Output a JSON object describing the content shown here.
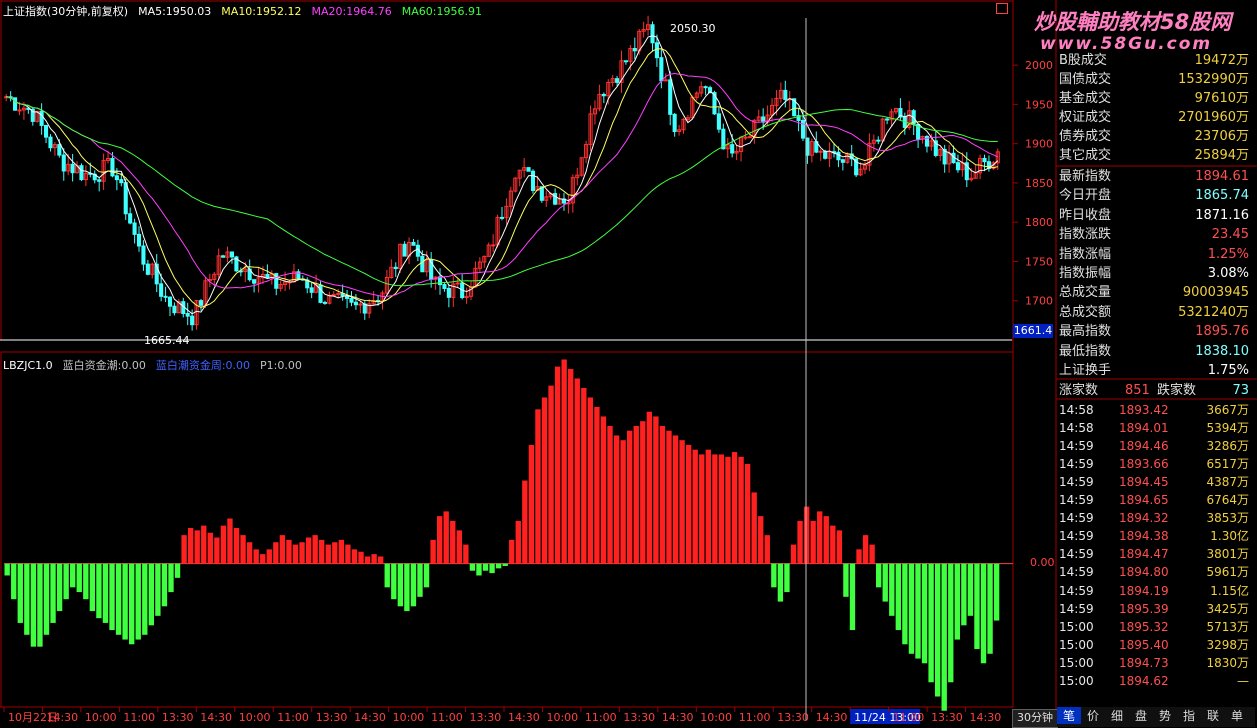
{
  "header": {
    "title": "上证指数(30分钟,前复权)",
    "ma5": "MA5:1950.03",
    "ma10": "MA10:1952.12",
    "ma20": "MA20:1964.76",
    "ma60": "MA60:1956.91"
  },
  "indicator_header": {
    "name": "LBZJC1.0",
    "blue_flow": "蓝白资金潮:0.00",
    "blue_wave": "蓝白潮资金周:0.00",
    "p1": "P1:0.00"
  },
  "watermark": {
    "line1": "炒股輔助教材58股网",
    "line2": "www.58Gu.com"
  },
  "price_labels": {
    "high_label": "2050.30",
    "low_label": "1665.44",
    "current_box": "1661.4",
    "zero_label": "0.00"
  },
  "x_axis_labels": [
    "10月22日",
    "14:30",
    "10:00",
    "11:00",
    "13:30",
    "14:30",
    "10:00",
    "11:00",
    "13:30",
    "14:30",
    "10:00",
    "11:00",
    "13:30",
    "14:30",
    "10:00",
    "11:00",
    "13:30",
    "14:30",
    "10:00",
    "11:00",
    "13:30",
    "14:30",
    "11/24 13:00",
    "11:00",
    "13:30",
    "14:30"
  ],
  "timeframe_label": "30分钟",
  "right_panel": {
    "top_rows": [
      {
        "label": "B股成交",
        "value": "19472万"
      },
      {
        "label": "国债成交",
        "value": "1532990万"
      },
      {
        "label": "基金成交",
        "value": "97610万"
      },
      {
        "label": "权证成交",
        "value": "2701960万"
      },
      {
        "label": "债券成交",
        "value": "23706万"
      },
      {
        "label": "其它成交",
        "value": "25894万"
      }
    ],
    "index_rows": [
      {
        "label": "最新指数",
        "value": "1894.61",
        "color": "#ff5050"
      },
      {
        "label": "今日开盘",
        "value": "1865.74",
        "color": "#80ffff"
      },
      {
        "label": "昨日收盘",
        "value": "1871.16",
        "color": "#ffffff"
      },
      {
        "label": "指数涨跌",
        "value": "23.45",
        "color": "#ff5050"
      },
      {
        "label": "指数涨幅",
        "value": "1.25%",
        "color": "#ff5050"
      },
      {
        "label": "指数振幅",
        "value": "3.08%",
        "color": "#ffffff"
      },
      {
        "label": "总成交量",
        "value": "90003945",
        "color": "#f0d040"
      },
      {
        "label": "总成交额",
        "value": "5321240万",
        "color": "#f0d040"
      },
      {
        "label": "最高指数",
        "value": "1895.76",
        "color": "#ff5050"
      },
      {
        "label": "最低指数",
        "value": "1838.10",
        "color": "#80ffff"
      },
      {
        "label": "上证换手",
        "value": "1.75%",
        "color": "#ffffff"
      }
    ],
    "breadth": {
      "up_label": "涨家数",
      "up_value": "851",
      "down_label": "跌家数",
      "down_value": "73"
    },
    "ticks": [
      {
        "time": "14:58",
        "price": "1893.42",
        "vol": "3667万"
      },
      {
        "time": "14:58",
        "price": "1894.01",
        "vol": "5394万"
      },
      {
        "time": "14:59",
        "price": "1894.46",
        "vol": "3286万"
      },
      {
        "time": "14:59",
        "price": "1893.66",
        "vol": "6517万"
      },
      {
        "time": "14:59",
        "price": "1894.45",
        "vol": "4387万"
      },
      {
        "time": "14:59",
        "price": "1894.65",
        "vol": "6764万"
      },
      {
        "time": "14:59",
        "price": "1894.32",
        "vol": "3853万"
      },
      {
        "time": "14:59",
        "price": "1894.38",
        "vol": "1.30亿"
      },
      {
        "time": "14:59",
        "price": "1894.47",
        "vol": "3801万"
      },
      {
        "time": "14:59",
        "price": "1894.80",
        "vol": "5961万"
      },
      {
        "time": "14:59",
        "price": "1894.19",
        "vol": "1.15亿"
      },
      {
        "time": "14:59",
        "price": "1895.39",
        "vol": "3425万"
      },
      {
        "time": "15:00",
        "price": "1895.32",
        "vol": "5713万"
      },
      {
        "time": "15:00",
        "price": "1895.40",
        "vol": "3298万"
      },
      {
        "time": "15:00",
        "price": "1894.73",
        "vol": "1830万"
      },
      {
        "time": "15:00",
        "price": "1894.62",
        "vol": "—"
      }
    ],
    "bottom_tabs": [
      "笔",
      "价",
      "细",
      "盘",
      "势",
      "指",
      "联",
      "单"
    ]
  },
  "chart_data": [
    {
      "type": "candlestick",
      "ylim": [
        1650,
        2060
      ],
      "y_ticks": [
        1700,
        1750,
        1800,
        1850,
        1900,
        1950,
        2000
      ],
      "close_anchors": [
        1960,
        1940,
        1880,
        1860,
        1870,
        1760,
        1700,
        1680,
        1760,
        1740,
        1720,
        1730,
        1700,
        1690,
        1710,
        1780,
        1720,
        1710,
        1760,
        1870,
        1840,
        1830,
        1960,
        2000,
        2050,
        1920,
        1980,
        1880,
        1920,
        1960,
        1890,
        1880,
        1870,
        1950,
        1920,
        1880,
        1860,
        1890
      ],
      "high_value": 2050.3,
      "low_value": 1665.44,
      "grid": false
    },
    {
      "type": "bar",
      "name": "LBZJC",
      "zero_line": 0,
      "ylim": [
        -6,
        9
      ],
      "values": [
        -0.5,
        -1.5,
        -2.5,
        -3,
        -3.5,
        -3.5,
        -3,
        -2.5,
        -2,
        -1.5,
        -1,
        -1.2,
        -1.5,
        -2,
        -2.3,
        -2.5,
        -2.8,
        -3,
        -3.2,
        -3.4,
        -3.2,
        -3,
        -2.6,
        -2.2,
        -1.8,
        -1.2,
        -0.6,
        1.2,
        1.5,
        1.4,
        1.6,
        1.3,
        1.1,
        1.6,
        1.9,
        1.5,
        1.2,
        0.9,
        0.6,
        0.4,
        0.6,
        0.9,
        1.2,
        1.0,
        0.8,
        0.9,
        1.1,
        1.2,
        1.0,
        0.8,
        0.9,
        1.0,
        0.8,
        0.6,
        0.5,
        0.3,
        0.4,
        0.3,
        -1.0,
        -1.5,
        -1.8,
        -2.0,
        -1.8,
        -1.4,
        -1.0,
        1.0,
        2.0,
        2.2,
        1.8,
        1.4,
        0.8,
        -0.3,
        -0.5,
        -0.3,
        -0.4,
        -0.2,
        -0.1,
        1.0,
        1.8,
        3.5,
        5.0,
        6.5,
        7.0,
        7.5,
        8.3,
        8.6,
        8.2,
        7.8,
        7.4,
        7.0,
        6.6,
        6.2,
        5.8,
        5.4,
        5.2,
        5.6,
        5.8,
        6.0,
        6.4,
        6.2,
        5.8,
        5.6,
        5.4,
        5.2,
        5.0,
        4.8,
        4.6,
        4.8,
        4.6,
        4.6,
        4.5,
        4.7,
        4.5,
        4.2,
        3.0,
        2.0,
        1.2,
        -1.0,
        -1.6,
        -1.2,
        0.8,
        1.8,
        2.4,
        1.8,
        2.2,
        2.0,
        1.6,
        1.4,
        -1.4,
        -2.8,
        0.6,
        1.2,
        0.8,
        -1.0,
        -1.6,
        -2.2,
        -2.8,
        -3.4,
        -3.8,
        -4.0,
        -4.2,
        -5.0,
        -5.6,
        -6.2,
        -5.0,
        -3.2,
        -2.6,
        -2.2,
        -3.6,
        -4.2,
        -3.8,
        -2.4
      ],
      "grid": false
    }
  ]
}
